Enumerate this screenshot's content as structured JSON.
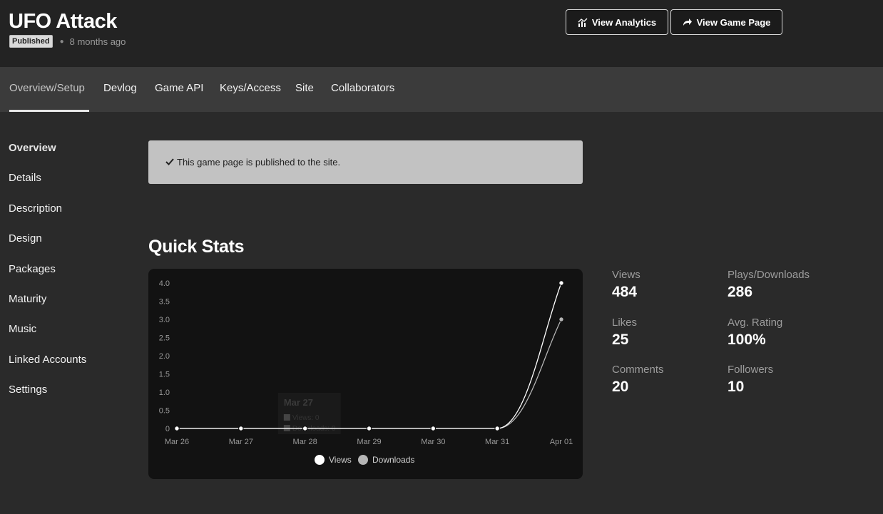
{
  "header": {
    "title": "UFO Attack",
    "status_badge": "Published",
    "updated": "8 months ago",
    "analytics_button": "View Analytics",
    "game_page_button": "View Game Page"
  },
  "tabs": [
    {
      "label": "Overview/Setup",
      "active": true
    },
    {
      "label": "Devlog"
    },
    {
      "label": "Game API"
    },
    {
      "label": "Keys/Access"
    },
    {
      "label": "Site"
    },
    {
      "label": "Collaborators"
    }
  ],
  "sidebar": {
    "items": [
      {
        "label": "Overview",
        "active": true
      },
      {
        "label": "Details"
      },
      {
        "label": "Description"
      },
      {
        "label": "Design"
      },
      {
        "label": "Packages"
      },
      {
        "label": "Maturity"
      },
      {
        "label": "Music"
      },
      {
        "label": "Linked Accounts"
      },
      {
        "label": "Settings"
      }
    ]
  },
  "notice": {
    "icon": "checkmark-icon",
    "text": "This game page is published to the site."
  },
  "quick_stats": {
    "title": "Quick Stats",
    "stats": [
      {
        "label": "Views",
        "value": "484"
      },
      {
        "label": "Plays/Downloads",
        "value": "286"
      },
      {
        "label": "Likes",
        "value": "25"
      },
      {
        "label": "Avg. Rating",
        "value": "100%"
      },
      {
        "label": "Comments",
        "value": "20"
      },
      {
        "label": "Followers",
        "value": "10"
      }
    ]
  },
  "chart_data": {
    "type": "line",
    "categories": [
      "Mar 26",
      "Mar 27",
      "Mar 28",
      "Mar 29",
      "Mar 30",
      "Mar 31",
      "Apr 01"
    ],
    "series": [
      {
        "name": "Views",
        "values": [
          0,
          0,
          0,
          0,
          0,
          0,
          4
        ],
        "color": "#ffffff"
      },
      {
        "name": "Downloads",
        "values": [
          0,
          0,
          0,
          0,
          0,
          0,
          3
        ],
        "color": "#b5b5b5"
      }
    ],
    "yticks": [
      "0",
      "0.5",
      "1.0",
      "1.5",
      "2.0",
      "2.5",
      "3.0",
      "3.5",
      "4.0"
    ],
    "ylim": [
      0,
      4
    ],
    "grid": false,
    "legend": "bottom",
    "tooltip": {
      "title": "Mar 27",
      "lines": [
        "Views: 0",
        "Downloads: 0"
      ]
    }
  },
  "colors": {
    "header_bg": "#232323",
    "tabbar_bg": "#3b3b3b",
    "page_bg": "#2a2a2a",
    "notice_bg": "#c2c2c2",
    "chart_bg": "#121212"
  }
}
